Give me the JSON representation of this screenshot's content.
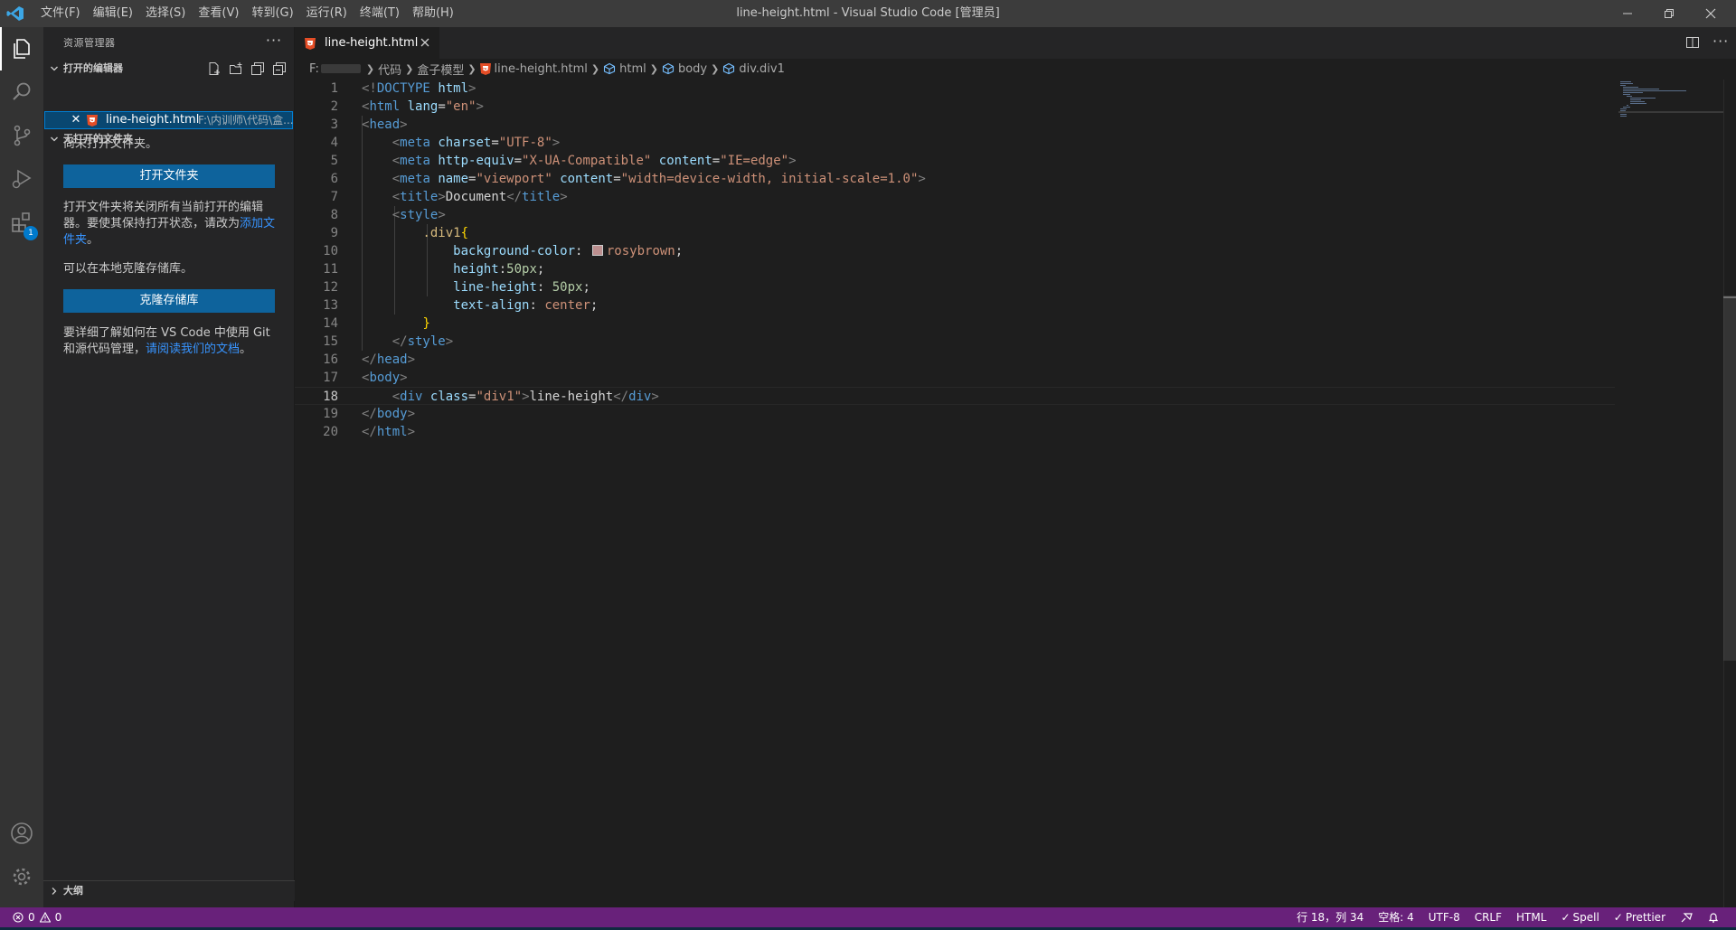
{
  "app": {
    "window_title": "line-height.html - Visual Studio Code [管理员]",
    "menu": [
      "文件(F)",
      "编辑(E)",
      "选择(S)",
      "查看(V)",
      "转到(G)",
      "运行(R)",
      "终端(T)",
      "帮助(H)"
    ]
  },
  "activity_bar": {
    "items": [
      "explorer-icon",
      "search-icon",
      "source-control-icon",
      "run-debug-icon",
      "extensions-icon"
    ],
    "extensions_badge": "1",
    "bottom": [
      "account-icon",
      "settings-gear-icon"
    ]
  },
  "sidebar": {
    "title": "资源管理器",
    "open_editors": {
      "label": "打开的编辑器",
      "items": [
        {
          "name": "line-height.html",
          "path": "F:\\内训师\\代码\\盒..."
        }
      ]
    },
    "no_folder": {
      "label": "无打开的文件夹",
      "msg_no_folder": "尚未打开文件夹。",
      "open_folder_button": "打开文件夹",
      "msg_close_editors": "打开文件夹将关闭所有当前打开的编辑器。要使其保持打开状态，请改为",
      "link_add_folder": "添加文件夹",
      "period": "。",
      "msg_clone": "可以在本地克隆存储库。",
      "clone_button": "克隆存储库",
      "msg_git": "要详细了解如何在 VS Code 中使用 Git 和源代码管理，",
      "link_docs": "请阅读我们的文档",
      "period2": "。"
    },
    "outline_label": "大纲"
  },
  "editor": {
    "tab": {
      "label": "line-height.html",
      "icon": "html5-icon"
    },
    "breadcrumbs": [
      "F:",
      "代码",
      "盒子模型",
      "line-height.html",
      "html",
      "body",
      "div.div1"
    ],
    "current_line": 18,
    "lines": [
      [
        [
          "t-brk",
          "<!"
        ],
        [
          "t-doct",
          "DOCTYPE"
        ],
        [
          "t-txt",
          " "
        ],
        [
          "t-attr",
          "html"
        ],
        [
          "t-brk",
          ">"
        ]
      ],
      [
        [
          "t-brk",
          "<"
        ],
        [
          "t-tag",
          "html"
        ],
        [
          "t-txt",
          " "
        ],
        [
          "t-attr",
          "lang"
        ],
        [
          "t-txt",
          "="
        ],
        [
          "t-str",
          "\"en\""
        ],
        [
          "t-brk",
          ">"
        ]
      ],
      [
        [
          "t-brk",
          "<"
        ],
        [
          "t-tag",
          "head"
        ],
        [
          "t-brk",
          ">"
        ]
      ],
      [
        [
          "t-txt",
          "    "
        ],
        [
          "t-brk",
          "<"
        ],
        [
          "t-tag",
          "meta"
        ],
        [
          "t-txt",
          " "
        ],
        [
          "t-attr",
          "charset"
        ],
        [
          "t-txt",
          "="
        ],
        [
          "t-str",
          "\"UTF-8\""
        ],
        [
          "t-brk",
          ">"
        ]
      ],
      [
        [
          "t-txt",
          "    "
        ],
        [
          "t-brk",
          "<"
        ],
        [
          "t-tag",
          "meta"
        ],
        [
          "t-txt",
          " "
        ],
        [
          "t-attr",
          "http-equiv"
        ],
        [
          "t-txt",
          "="
        ],
        [
          "t-str",
          "\"X-UA-Compatible\""
        ],
        [
          "t-txt",
          " "
        ],
        [
          "t-attr",
          "content"
        ],
        [
          "t-txt",
          "="
        ],
        [
          "t-str",
          "\"IE=edge\""
        ],
        [
          "t-brk",
          ">"
        ]
      ],
      [
        [
          "t-txt",
          "    "
        ],
        [
          "t-brk",
          "<"
        ],
        [
          "t-tag",
          "meta"
        ],
        [
          "t-txt",
          " "
        ],
        [
          "t-attr",
          "name"
        ],
        [
          "t-txt",
          "="
        ],
        [
          "t-str",
          "\"viewport\""
        ],
        [
          "t-txt",
          " "
        ],
        [
          "t-attr",
          "content"
        ],
        [
          "t-txt",
          "="
        ],
        [
          "t-str",
          "\"width=device-width, initial-scale=1.0\""
        ],
        [
          "t-brk",
          ">"
        ]
      ],
      [
        [
          "t-txt",
          "    "
        ],
        [
          "t-brk",
          "<"
        ],
        [
          "t-tag",
          "title"
        ],
        [
          "t-brk",
          ">"
        ],
        [
          "t-txt",
          "Document"
        ],
        [
          "t-brk",
          "</"
        ],
        [
          "t-tag",
          "title"
        ],
        [
          "t-brk",
          ">"
        ]
      ],
      [
        [
          "t-txt",
          "    "
        ],
        [
          "t-brk",
          "<"
        ],
        [
          "t-tag",
          "style"
        ],
        [
          "t-brk",
          ">"
        ]
      ],
      [
        [
          "t-txt",
          "        "
        ],
        [
          "t-sel",
          ".div1"
        ],
        [
          "t-brace",
          "{"
        ]
      ],
      [
        [
          "t-txt",
          "            "
        ],
        [
          "t-prop",
          "background-color"
        ],
        [
          "t-txt",
          ": "
        ],
        [
          "swatch",
          "#bc8f8f"
        ],
        [
          "t-val",
          "rosybrown"
        ],
        [
          "t-txt",
          ";"
        ]
      ],
      [
        [
          "t-txt",
          "            "
        ],
        [
          "t-prop",
          "height"
        ],
        [
          "t-txt",
          ":"
        ],
        [
          "t-num",
          "50px"
        ],
        [
          "t-txt",
          ";"
        ]
      ],
      [
        [
          "t-txt",
          "            "
        ],
        [
          "t-prop",
          "line-height"
        ],
        [
          "t-txt",
          ": "
        ],
        [
          "t-num",
          "50px"
        ],
        [
          "t-txt",
          ";"
        ]
      ],
      [
        [
          "t-txt",
          "            "
        ],
        [
          "t-prop",
          "text-align"
        ],
        [
          "t-txt",
          ": "
        ],
        [
          "t-val",
          "center"
        ],
        [
          "t-txt",
          ";"
        ]
      ],
      [
        [
          "t-txt",
          "        "
        ],
        [
          "t-brace",
          "}"
        ]
      ],
      [
        [
          "t-txt",
          "    "
        ],
        [
          "t-brk",
          "</"
        ],
        [
          "t-tag",
          "style"
        ],
        [
          "t-brk",
          ">"
        ]
      ],
      [
        [
          "t-brk",
          "</"
        ],
        [
          "t-tag",
          "head"
        ],
        [
          "t-brk",
          ">"
        ]
      ],
      [
        [
          "t-brk",
          "<"
        ],
        [
          "t-tag",
          "body"
        ],
        [
          "t-brk",
          ">"
        ]
      ],
      [
        [
          "t-txt",
          "    "
        ],
        [
          "t-brk",
          "<"
        ],
        [
          "t-tag",
          "div"
        ],
        [
          "t-txt",
          " "
        ],
        [
          "t-attr",
          "class"
        ],
        [
          "t-txt",
          "="
        ],
        [
          "t-str",
          "\"div1\""
        ],
        [
          "t-brk",
          ">"
        ],
        [
          "t-txt",
          "line-height"
        ],
        [
          "t-brk",
          "</"
        ],
        [
          "t-tag",
          "div"
        ],
        [
          "t-brk",
          ">"
        ]
      ],
      [
        [
          "t-brk",
          "</"
        ],
        [
          "t-tag",
          "body"
        ],
        [
          "t-brk",
          ">"
        ]
      ],
      [
        [
          "t-brk",
          "</"
        ],
        [
          "t-tag",
          "html"
        ],
        [
          "t-brk",
          ">"
        ]
      ]
    ]
  },
  "status_bar": {
    "errors": "0",
    "warnings": "0",
    "position": "行 18，列 34",
    "spaces": "空格: 4",
    "encoding": "UTF-8",
    "eol": "CRLF",
    "language": "HTML",
    "spell": "Spell",
    "prettier": "Prettier"
  },
  "colors": {
    "status_bar": "#68217a",
    "accent": "#007acc",
    "button": "#0e639c",
    "swatch_rosybrown": "#bc8f8f"
  }
}
